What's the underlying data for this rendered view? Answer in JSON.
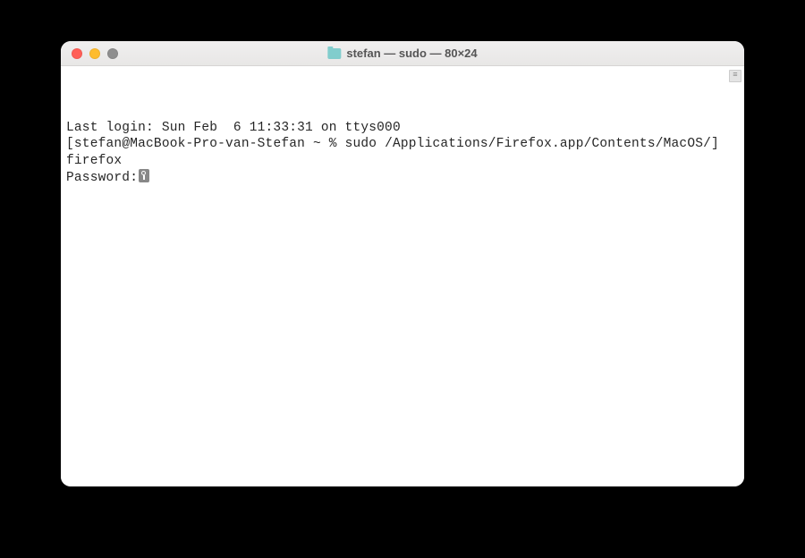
{
  "window": {
    "title": "stefan — sudo — 80×24"
  },
  "terminal": {
    "line1": "Last login: Sun Feb  6 11:33:31 on ttys000",
    "line2_prompt_open": "[",
    "line2_host": "stefan@MacBook-Pro-van-Stefan ~ % ",
    "line2_cmd": "sudo /Applications/Firefox.app/Contents/MacOS/",
    "line2_prompt_close": "]",
    "line3": "firefox",
    "line4": "Password:"
  }
}
